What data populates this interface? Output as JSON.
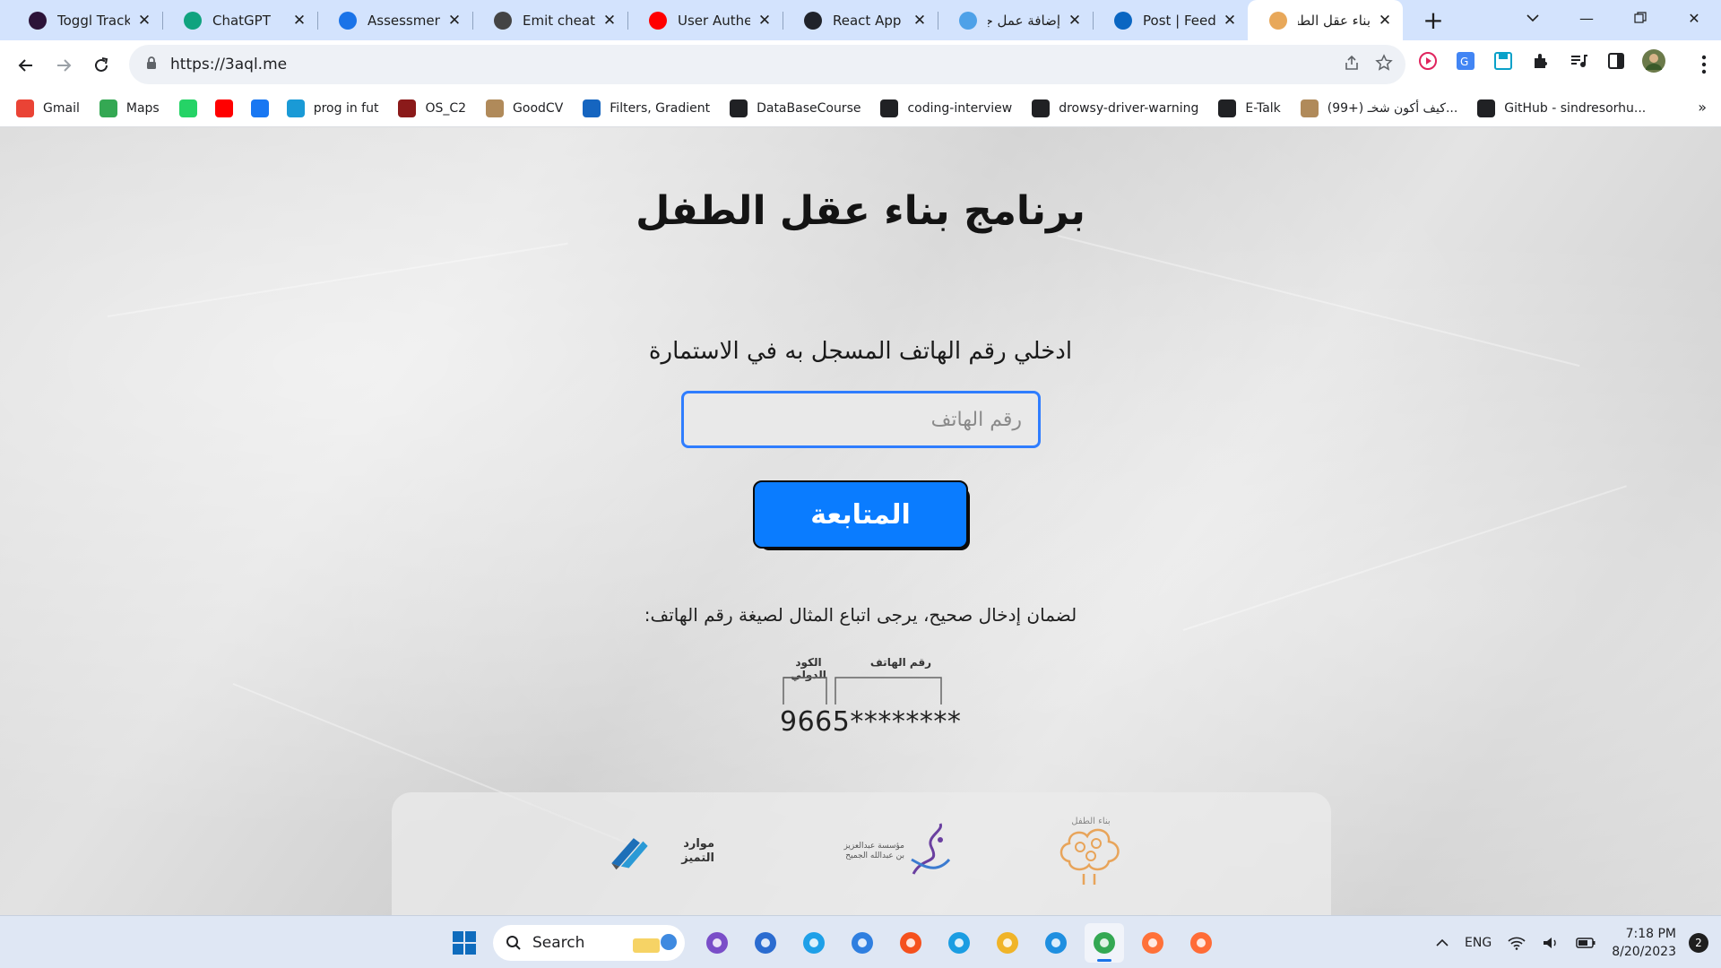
{
  "browser": {
    "tabs": [
      {
        "title": "Toggl Track",
        "icon": "toggl-icon",
        "color": "#2c1338"
      },
      {
        "title": "ChatGPT",
        "icon": "chatgpt-icon",
        "color": "#10a37f"
      },
      {
        "title": "Assessment P",
        "icon": "coursera-icon",
        "color": "#1a73e8"
      },
      {
        "title": "Emit cheatshe",
        "icon": "compass-icon",
        "color": "#444444"
      },
      {
        "title": "User Authenti",
        "icon": "youtube-icon",
        "color": "#ff0000"
      },
      {
        "title": "React App",
        "icon": "react-icon",
        "color": "#20232a"
      },
      {
        "title": "إضافة عمل جـ",
        "icon": "circle-icon",
        "color": "#4ea1e8"
      },
      {
        "title": "Post | Feed | L",
        "icon": "linkedin-icon",
        "color": "#0a66c2"
      },
      {
        "title": "بناء عقل الطفل",
        "icon": "brain-icon",
        "color": "#e8a85a",
        "active": true
      }
    ],
    "url": "https://3aql.me",
    "bookmarks": [
      {
        "label": "Gmail",
        "icon": "gmail-icon",
        "color": "#ea4335"
      },
      {
        "label": "Maps",
        "icon": "maps-icon",
        "color": "#34a853"
      },
      {
        "label": "",
        "icon": "whatsapp-icon",
        "color": "#25d366"
      },
      {
        "label": "",
        "icon": "youtube-icon",
        "color": "#ff0000"
      },
      {
        "label": "",
        "icon": "facebook-icon",
        "color": "#1877f2"
      },
      {
        "label": "prog in fut",
        "icon": "caduceus-icon",
        "color": "#1a9ad6"
      },
      {
        "label": "OS_C2",
        "icon": "shield-icon",
        "color": "#8b1a1a"
      },
      {
        "label": "GoodCV",
        "icon": "avatar-icon",
        "color": "#b08a5a"
      },
      {
        "label": "Filters, Gradient",
        "icon": "letter-e-icon",
        "color": "#1565c0"
      },
      {
        "label": "DataBaseCourse",
        "icon": "globe-icon",
        "color": "#202124"
      },
      {
        "label": "coding-interview",
        "icon": "github-icon",
        "color": "#202124"
      },
      {
        "label": "drowsy-driver-warning",
        "icon": "github-icon",
        "color": "#202124"
      },
      {
        "label": "E-Talk",
        "icon": "github-icon",
        "color": "#202124"
      },
      {
        "label": "(99+) كيف أكون شخـ...",
        "icon": "avatar-icon",
        "color": "#b08a5a"
      },
      {
        "label": "GitHub - sindresorhu...",
        "icon": "github-icon",
        "color": "#202124"
      }
    ]
  },
  "page": {
    "heading": "برنامج بناء عقل الطفل",
    "prompt": "ادخلي رقم الهاتف المسجل به في الاستمارة",
    "phone_placeholder": "رقم الهاتف",
    "continue_label": "المتابعة",
    "hint": "لضمان إدخال صحيح، يرجى اتباع المثال لصيغة رقم الهاتف:",
    "example": {
      "phone_label": "رقم الهاتف",
      "country_label": "الكود الدولي",
      "number": "9665********"
    },
    "footer_logos": [
      {
        "name": "moared-altamayoz-logo",
        "text": "موارد التميز"
      },
      {
        "name": "foundation-logo",
        "text": "مؤسسة عبدالعزيز بن عبدالله الجميح"
      },
      {
        "name": "bina-aql-altifl-logo",
        "text": "بناء الطفل"
      }
    ],
    "accent_color": "#0a7cff"
  },
  "taskbar": {
    "search_label": "Search",
    "language": "ENG",
    "time": "7:18 PM",
    "date": "8/20/2023",
    "notifications": "2",
    "apps": [
      "visual-studio-icon",
      "store-icon",
      "help-icon",
      "todo-icon",
      "brave-icon",
      "edge-icon",
      "file-explorer-icon",
      "vscode-icon",
      "chrome-icon",
      "firefox-icon",
      "postman-icon"
    ]
  }
}
